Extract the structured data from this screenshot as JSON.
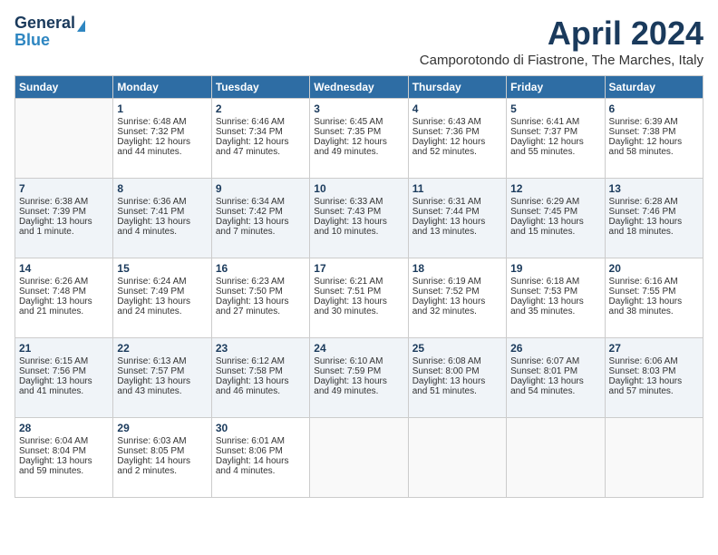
{
  "logo": {
    "line1": "General",
    "line2": "Blue"
  },
  "title": "April 2024",
  "location": "Camporotondo di Fiastrone, The Marches, Italy",
  "headers": [
    "Sunday",
    "Monday",
    "Tuesday",
    "Wednesday",
    "Thursday",
    "Friday",
    "Saturday"
  ],
  "weeks": [
    [
      {
        "day": "",
        "content": ""
      },
      {
        "day": "1",
        "content": "Sunrise: 6:48 AM\nSunset: 7:32 PM\nDaylight: 12 hours\nand 44 minutes."
      },
      {
        "day": "2",
        "content": "Sunrise: 6:46 AM\nSunset: 7:34 PM\nDaylight: 12 hours\nand 47 minutes."
      },
      {
        "day": "3",
        "content": "Sunrise: 6:45 AM\nSunset: 7:35 PM\nDaylight: 12 hours\nand 49 minutes."
      },
      {
        "day": "4",
        "content": "Sunrise: 6:43 AM\nSunset: 7:36 PM\nDaylight: 12 hours\nand 52 minutes."
      },
      {
        "day": "5",
        "content": "Sunrise: 6:41 AM\nSunset: 7:37 PM\nDaylight: 12 hours\nand 55 minutes."
      },
      {
        "day": "6",
        "content": "Sunrise: 6:39 AM\nSunset: 7:38 PM\nDaylight: 12 hours\nand 58 minutes."
      }
    ],
    [
      {
        "day": "7",
        "content": "Sunrise: 6:38 AM\nSunset: 7:39 PM\nDaylight: 13 hours\nand 1 minute."
      },
      {
        "day": "8",
        "content": "Sunrise: 6:36 AM\nSunset: 7:41 PM\nDaylight: 13 hours\nand 4 minutes."
      },
      {
        "day": "9",
        "content": "Sunrise: 6:34 AM\nSunset: 7:42 PM\nDaylight: 13 hours\nand 7 minutes."
      },
      {
        "day": "10",
        "content": "Sunrise: 6:33 AM\nSunset: 7:43 PM\nDaylight: 13 hours\nand 10 minutes."
      },
      {
        "day": "11",
        "content": "Sunrise: 6:31 AM\nSunset: 7:44 PM\nDaylight: 13 hours\nand 13 minutes."
      },
      {
        "day": "12",
        "content": "Sunrise: 6:29 AM\nSunset: 7:45 PM\nDaylight: 13 hours\nand 15 minutes."
      },
      {
        "day": "13",
        "content": "Sunrise: 6:28 AM\nSunset: 7:46 PM\nDaylight: 13 hours\nand 18 minutes."
      }
    ],
    [
      {
        "day": "14",
        "content": "Sunrise: 6:26 AM\nSunset: 7:48 PM\nDaylight: 13 hours\nand 21 minutes."
      },
      {
        "day": "15",
        "content": "Sunrise: 6:24 AM\nSunset: 7:49 PM\nDaylight: 13 hours\nand 24 minutes."
      },
      {
        "day": "16",
        "content": "Sunrise: 6:23 AM\nSunset: 7:50 PM\nDaylight: 13 hours\nand 27 minutes."
      },
      {
        "day": "17",
        "content": "Sunrise: 6:21 AM\nSunset: 7:51 PM\nDaylight: 13 hours\nand 30 minutes."
      },
      {
        "day": "18",
        "content": "Sunrise: 6:19 AM\nSunset: 7:52 PM\nDaylight: 13 hours\nand 32 minutes."
      },
      {
        "day": "19",
        "content": "Sunrise: 6:18 AM\nSunset: 7:53 PM\nDaylight: 13 hours\nand 35 minutes."
      },
      {
        "day": "20",
        "content": "Sunrise: 6:16 AM\nSunset: 7:55 PM\nDaylight: 13 hours\nand 38 minutes."
      }
    ],
    [
      {
        "day": "21",
        "content": "Sunrise: 6:15 AM\nSunset: 7:56 PM\nDaylight: 13 hours\nand 41 minutes."
      },
      {
        "day": "22",
        "content": "Sunrise: 6:13 AM\nSunset: 7:57 PM\nDaylight: 13 hours\nand 43 minutes."
      },
      {
        "day": "23",
        "content": "Sunrise: 6:12 AM\nSunset: 7:58 PM\nDaylight: 13 hours\nand 46 minutes."
      },
      {
        "day": "24",
        "content": "Sunrise: 6:10 AM\nSunset: 7:59 PM\nDaylight: 13 hours\nand 49 minutes."
      },
      {
        "day": "25",
        "content": "Sunrise: 6:08 AM\nSunset: 8:00 PM\nDaylight: 13 hours\nand 51 minutes."
      },
      {
        "day": "26",
        "content": "Sunrise: 6:07 AM\nSunset: 8:01 PM\nDaylight: 13 hours\nand 54 minutes."
      },
      {
        "day": "27",
        "content": "Sunrise: 6:06 AM\nSunset: 8:03 PM\nDaylight: 13 hours\nand 57 minutes."
      }
    ],
    [
      {
        "day": "28",
        "content": "Sunrise: 6:04 AM\nSunset: 8:04 PM\nDaylight: 13 hours\nand 59 minutes."
      },
      {
        "day": "29",
        "content": "Sunrise: 6:03 AM\nSunset: 8:05 PM\nDaylight: 14 hours\nand 2 minutes."
      },
      {
        "day": "30",
        "content": "Sunrise: 6:01 AM\nSunset: 8:06 PM\nDaylight: 14 hours\nand 4 minutes."
      },
      {
        "day": "",
        "content": ""
      },
      {
        "day": "",
        "content": ""
      },
      {
        "day": "",
        "content": ""
      },
      {
        "day": "",
        "content": ""
      }
    ]
  ]
}
